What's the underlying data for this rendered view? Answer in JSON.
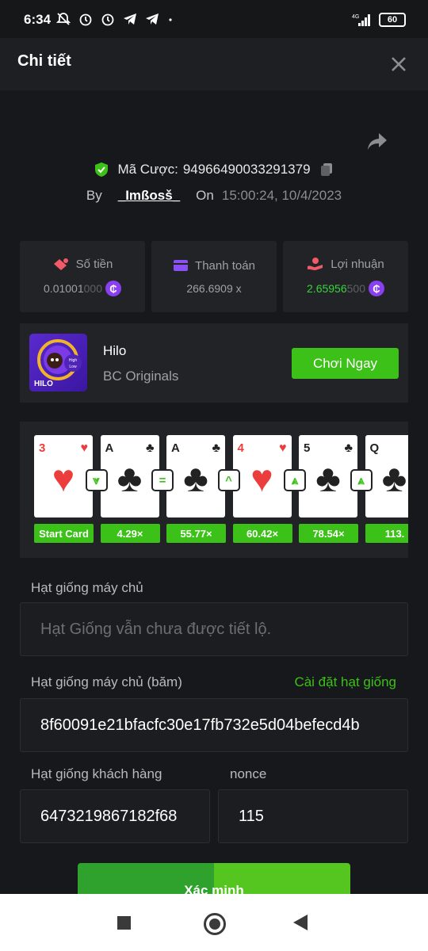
{
  "status_bar": {
    "time": "6:34",
    "network": "4G",
    "battery": "60"
  },
  "header": {
    "title": "Chi tiết"
  },
  "bet": {
    "id_label": "Mã Cược:",
    "id_value": "94966490033291379",
    "by_label": "By",
    "username": "_Imßosš_",
    "on_label": "On",
    "datetime": "15:00:24, 10/4/2023"
  },
  "stats": {
    "amount": {
      "label": "Số tiền",
      "value_main": "0.01001",
      "value_dim": "000"
    },
    "payout": {
      "label": "Thanh toán",
      "value": "266.6909 x"
    },
    "profit": {
      "label": "Lợi nhuận",
      "value_main": "2.65956",
      "value_dim": "500"
    },
    "coin_symbol": "₵"
  },
  "game": {
    "name": "Hilo",
    "provider": "BC Originals",
    "thumb_label": "HILO",
    "thumb_badge_top": "High",
    "thumb_badge_bottom": "Low",
    "play_label": "Chơi Ngay"
  },
  "cards": [
    {
      "rank": "3",
      "suit": "♥",
      "color": "red",
      "multiplier": "Start Card",
      "arrow": ""
    },
    {
      "rank": "A",
      "suit": "♣",
      "color": "black",
      "multiplier": "4.29×",
      "arrow": "⩔"
    },
    {
      "rank": "A",
      "suit": "♣",
      "color": "black",
      "multiplier": "55.77×",
      "arrow": "="
    },
    {
      "rank": "4",
      "suit": "♥",
      "color": "red",
      "multiplier": "60.42×",
      "arrow": "^"
    },
    {
      "rank": "5",
      "suit": "♣",
      "color": "black",
      "multiplier": "78.54×",
      "arrow": "⩓"
    },
    {
      "rank": "Q",
      "suit": "♣",
      "color": "black",
      "multiplier": "113.",
      "arrow": "⩓"
    }
  ],
  "seeds": {
    "server_seed_label": "Hạt giống máy chủ",
    "server_seed_placeholder": "Hạt Giống vẫn chưa được tiết lộ.",
    "server_hash_label": "Hạt giống máy chủ (băm)",
    "settings_link": "Cài đặt hạt giống",
    "server_hash_value": "8f60091e21bfacfc30e17fb732e5d04befecd4b",
    "client_seed_label": "Hạt giống khách hàng",
    "client_seed_value": "6473219867182f68",
    "nonce_label": "nonce",
    "nonce_value": "115"
  },
  "verify_label": "Xác minh",
  "colors": {
    "accent_green": "#3bc117",
    "coin_purple": "#8a3ff0",
    "background": "#17181b"
  }
}
